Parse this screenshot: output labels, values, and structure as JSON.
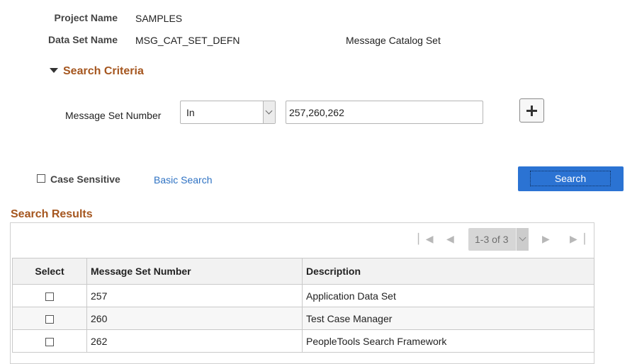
{
  "header": {
    "project_label": "Project Name",
    "project_value": "SAMPLES",
    "dataset_label": "Data Set Name",
    "dataset_value": "MSG_CAT_SET_DEFN",
    "dataset_description": "Message Catalog Set"
  },
  "search_criteria": {
    "title": "Search Criteria",
    "field_label": "Message Set Number",
    "operator_value": "In",
    "input_value": "257,260,262",
    "case_sensitive_label": "Case Sensitive",
    "basic_search_label": "Basic Search",
    "search_button_label": "Search"
  },
  "results": {
    "title": "Search Results",
    "pager_text": "1-3 of 3",
    "columns": [
      "Select",
      "Message Set Number",
      "Description"
    ],
    "rows": [
      {
        "number": "257",
        "description": "Application Data Set"
      },
      {
        "number": "260",
        "description": "Test Case Manager"
      },
      {
        "number": "262",
        "description": "PeopleTools Search Framework"
      }
    ]
  }
}
